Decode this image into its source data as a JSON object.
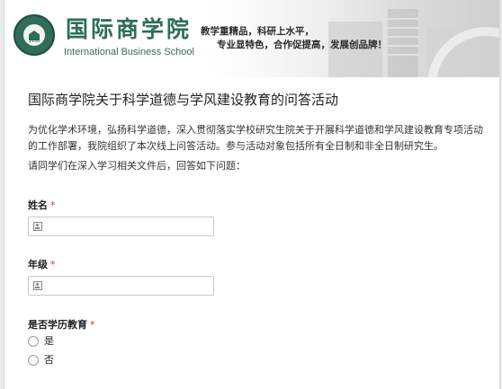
{
  "banner": {
    "school_name_cn": "国际商学院",
    "school_name_en": "International Business School",
    "seal_year": "1958",
    "motto_line1": "教学重精品，科研上水平，",
    "motto_line2": "专业显特色，合作促提高，发展创品牌！",
    "brand_color": "#2f6d5a"
  },
  "form": {
    "title": "国际商学院关于科学道德与学风建设教育的问答活动",
    "intro": "为优化学术环境，弘扬科学道德，深入贯彻落实学校研究生院关于开展科学道德和学风建设教育专项活动的工作部署，我院组织了本次线上问答活动。参与活动对象包括所有全日制和非全日制研究生。",
    "instruction": "请同学们在深入学习相关文件后，回答如下问题：",
    "required_mark": "*",
    "questions": [
      {
        "label": "姓名",
        "type": "text",
        "icon": "contact-card-icon",
        "value": ""
      },
      {
        "label": "年级",
        "type": "text",
        "icon": "contact-card-icon",
        "value": ""
      },
      {
        "label": "是否学历教育",
        "type": "radio",
        "options": [
          "是",
          "否"
        ]
      }
    ]
  }
}
